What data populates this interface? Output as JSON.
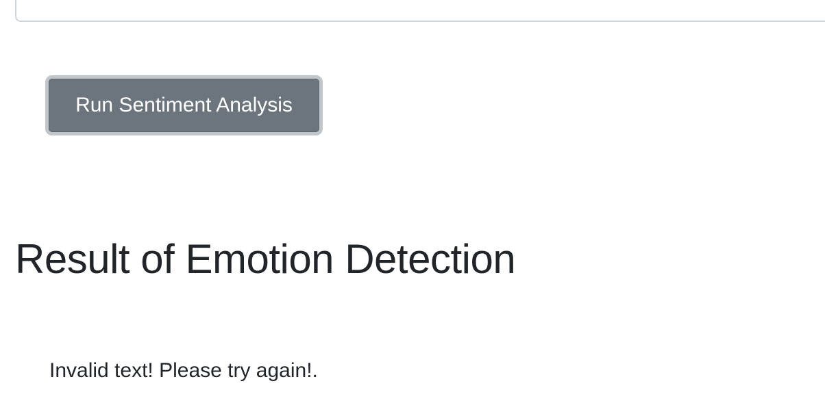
{
  "form": {
    "run_button_label": "Run Sentiment Analysis"
  },
  "result": {
    "heading": "Result of Emotion Detection",
    "message": "Invalid text! Please try again!."
  }
}
